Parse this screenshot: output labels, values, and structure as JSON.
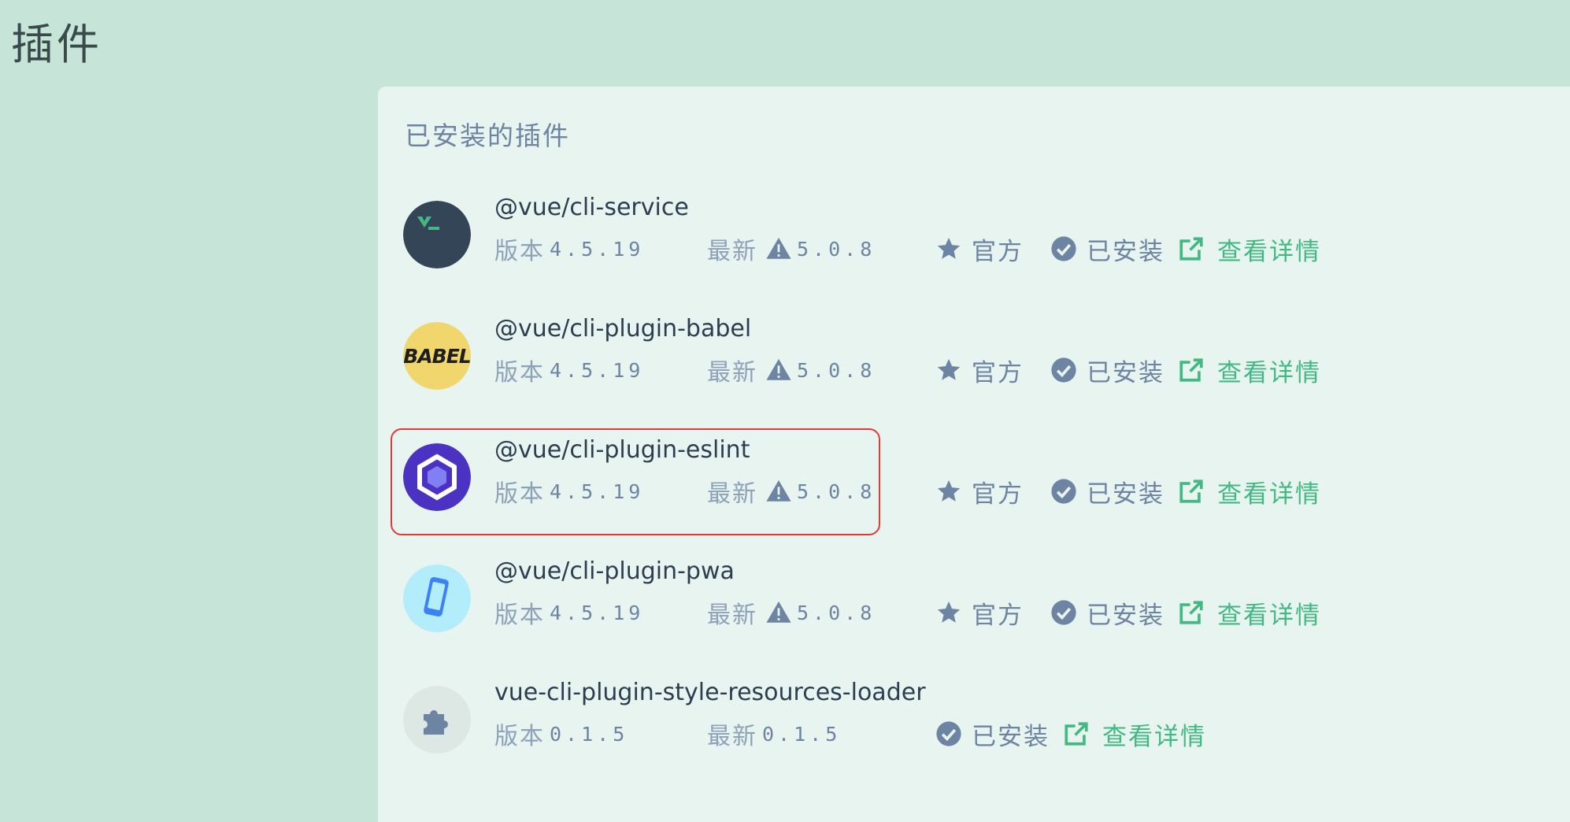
{
  "page": {
    "title": "插件"
  },
  "section": {
    "title": "已安装的插件"
  },
  "labels": {
    "version": "版本",
    "latest": "最新",
    "official": "官方",
    "installed": "已安装",
    "details": "查看详情"
  },
  "colors": {
    "accent": "#42b983",
    "muted": "#6e84a3",
    "highlight": "#e53935"
  },
  "plugins": [
    {
      "name": "@vue/cli-service",
      "version": "4.5.19",
      "latest": "5.0.8",
      "outdated": true,
      "official": true,
      "icon": "vue-cli-terminal-icon"
    },
    {
      "name": "@vue/cli-plugin-babel",
      "version": "4.5.19",
      "latest": "5.0.8",
      "outdated": true,
      "official": true,
      "icon": "babel-logo-icon"
    },
    {
      "name": "@vue/cli-plugin-eslint",
      "version": "4.5.19",
      "latest": "5.0.8",
      "outdated": true,
      "official": true,
      "icon": "eslint-logo-icon",
      "highlighted": true
    },
    {
      "name": "@vue/cli-plugin-pwa",
      "version": "4.5.19",
      "latest": "5.0.8",
      "outdated": true,
      "official": true,
      "icon": "mobile-phone-icon"
    },
    {
      "name": "vue-cli-plugin-style-resources-loader",
      "version": "0.1.5",
      "latest": "0.1.5",
      "outdated": false,
      "official": false,
      "icon": "puzzle-piece-icon"
    }
  ]
}
